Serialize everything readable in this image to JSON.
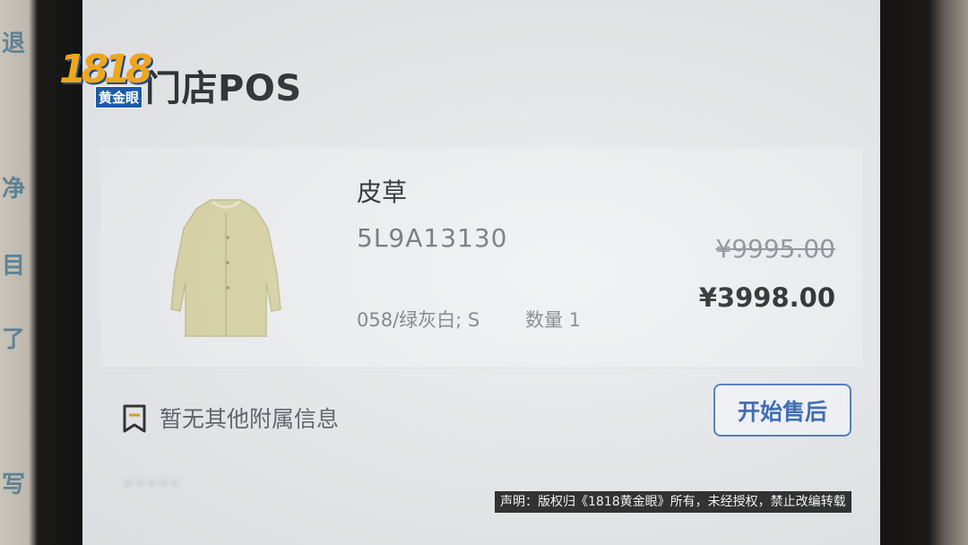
{
  "logo": {
    "number": "1818",
    "tag": "黄金眼"
  },
  "left_edge_glyphs": [
    "退",
    "净",
    "目",
    "了",
    "写"
  ],
  "page": {
    "title": "门店POS"
  },
  "product": {
    "name": "皮草",
    "sku": "5L9A13130",
    "variant": "058/绿灰白; S",
    "quantity_label": "数量 1",
    "original_price": "¥9995.00",
    "sale_price": "¥3998.00",
    "image_icon": "coat-image"
  },
  "footer": {
    "note_icon": "bookmark-icon",
    "note_text": "暂无其他附属信息",
    "aftersale_label": "开始售后",
    "accent_color": "#2f63b0"
  },
  "disclaimer": "声明：版权归《1818黄金眼》所有，未经授权，禁止改编转载"
}
